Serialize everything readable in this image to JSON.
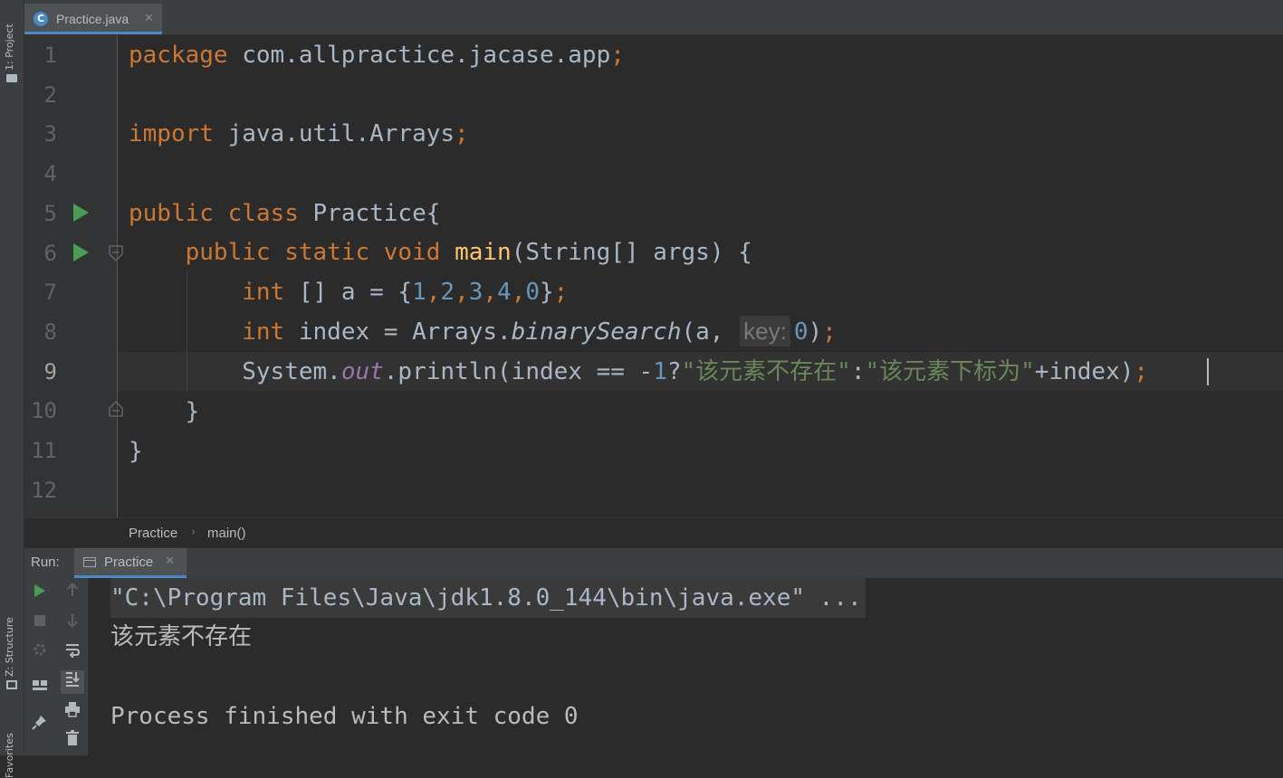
{
  "side_panels": {
    "project": "1: Project",
    "structure": "Z: Structure",
    "favorites": "Favorites"
  },
  "tab": {
    "file_name": "Practice.java",
    "icon_letter": "C",
    "close": "✕"
  },
  "editor": {
    "line_numbers": [
      "1",
      "2",
      "3",
      "4",
      "5",
      "6",
      "7",
      "8",
      "9",
      "10",
      "11",
      "12"
    ],
    "current_line": 9,
    "lines": {
      "l1": {
        "kw": "package",
        "rest": " com.allpractice.jacase.app",
        "semi": ";"
      },
      "l3": {
        "kw": "import",
        "rest": " java.util.Arrays",
        "semi": ";"
      },
      "l5": {
        "kw1": "public",
        "kw2": "class",
        "rest": " Practice{"
      },
      "l6": {
        "kw1": "public",
        "kw2": "static",
        "kw3": "void",
        "fn": "main",
        "rest": "(String[] args) {"
      },
      "l7": {
        "kw": "int",
        "rest": " [] a = {",
        "n1": "1",
        "c": ",",
        "n2": "2",
        "n3": "3",
        "n4": "4",
        "n5": "0",
        "close": "}",
        "semi": ";"
      },
      "l8": {
        "kw": "int",
        "pre": " index = Arrays.",
        "method": "binarySearch",
        "args": "(a,",
        "hint": "key:",
        "num": "0",
        "close": ")",
        "semi": ";"
      },
      "l9": {
        "pre": "System.",
        "field": "out",
        "mid": ".println(index == -",
        "num": "1",
        "q": "?",
        "str1": "\"该元素不存在\"",
        "colon": ":",
        "str2": "\"该元素下标为\"",
        "tail": "+index)",
        "semi": ";"
      },
      "l10": "}",
      "l11": "}"
    }
  },
  "breadcrumb": {
    "class_name": "Practice",
    "separator": "›",
    "method": "main()"
  },
  "run": {
    "label": "Run:",
    "tab_label": "Practice",
    "close": "✕",
    "output": {
      "command": "\"C:\\Program Files\\Java\\jdk1.8.0_144\\bin\\java.exe\" ...",
      "result": "该元素不存在",
      "finished": "Process finished with exit code 0"
    }
  },
  "colors": {
    "keyword": "#cc7832",
    "number": "#6897bb",
    "string": "#6a8759",
    "function": "#ffc66d",
    "field": "#9876aa",
    "run_green": "#499c54",
    "accent": "#4a88c7"
  }
}
